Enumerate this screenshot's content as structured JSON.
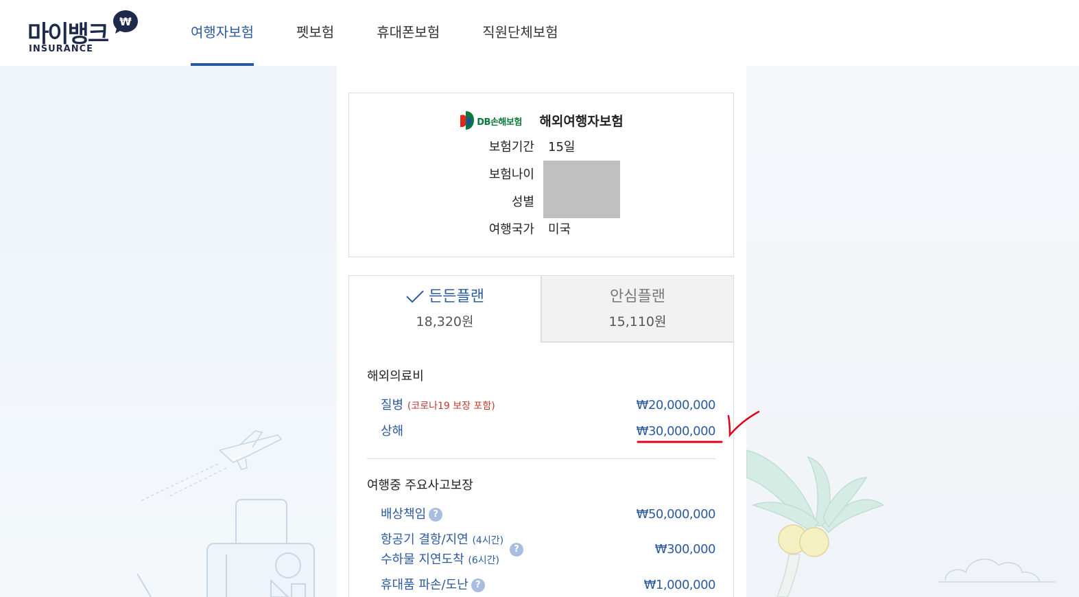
{
  "header": {
    "logo_text": "마이뱅크",
    "logo_sub": "INSURANCE",
    "logo_bubble_symbol": "₩",
    "nav": [
      {
        "label": "여행자보험",
        "active": true
      },
      {
        "label": "펫보험",
        "active": false
      },
      {
        "label": "휴대폰보험",
        "active": false
      },
      {
        "label": "직원단체보험",
        "active": false
      }
    ]
  },
  "summary": {
    "insurer": "DB손해보험",
    "product": "해외여행자보험",
    "rows": {
      "period": {
        "label": "보험기간",
        "value": "15일"
      },
      "age": {
        "label": "보험나이",
        "value": ""
      },
      "gender": {
        "label": "성별",
        "value": ""
      },
      "country": {
        "label": "여행국가",
        "value": "미국"
      }
    }
  },
  "plans": [
    {
      "name": "든든플랜",
      "price": "18,320원",
      "selected": true
    },
    {
      "name": "안심플랜",
      "price": "15,110원",
      "selected": false
    }
  ],
  "coverage": {
    "medical": {
      "title": "해외의료비",
      "items": [
        {
          "name": "질병",
          "note": "(코로나19 보장 포함)",
          "amount": "₩20,000,000"
        },
        {
          "name": "상해",
          "note": "",
          "amount": "₩30,000,000"
        }
      ]
    },
    "accident": {
      "title": "여행중 주요사고보장",
      "items": [
        {
          "name": "배상책임",
          "amount": "₩50,000,000"
        },
        {
          "name_line1": "항공기 결항/지연",
          "note1": "(4시간)",
          "name_line2": "수하물 지연도착",
          "note2": "(6시간)",
          "amount": "₩300,000"
        },
        {
          "name": "휴대품 파손/도난",
          "amount": "₩1,000,000"
        }
      ]
    },
    "help_symbol": "?"
  },
  "colors": {
    "accent": "#2c5aa0",
    "logo": "#1e2a4a",
    "note_red": "#c0392b",
    "annotation": "#e0001a"
  }
}
